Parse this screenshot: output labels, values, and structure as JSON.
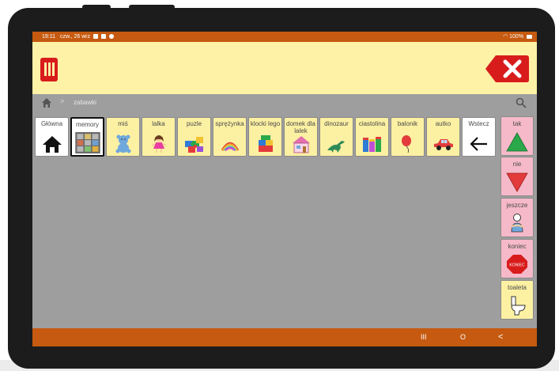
{
  "status_bar": {
    "time": "19:11",
    "date": "czw., 26 wrz",
    "battery": "100%"
  },
  "path": {
    "separator": ">",
    "crumb": "zabawki"
  },
  "tiles": [
    {
      "label": "Główna",
      "icon": "home-icon",
      "style": "white"
    },
    {
      "label": "memory",
      "icon": "memory-game-icon",
      "style": "white",
      "selected": true
    },
    {
      "label": "miś",
      "icon": "teddy-bear-icon",
      "style": "yellow"
    },
    {
      "label": "lalka",
      "icon": "doll-icon",
      "style": "yellow"
    },
    {
      "label": "puzle",
      "icon": "puzzle-icon",
      "style": "yellow"
    },
    {
      "label": "sprężynka",
      "icon": "slinky-icon",
      "style": "yellow"
    },
    {
      "label": "klocki lego",
      "icon": "lego-bricks-icon",
      "style": "yellow"
    },
    {
      "label": "domek dla lalek",
      "icon": "dollhouse-icon",
      "style": "yellow"
    },
    {
      "label": "dinozaur",
      "icon": "dinosaur-icon",
      "style": "yellow"
    },
    {
      "label": "ciastolina",
      "icon": "play-dough-icon",
      "style": "yellow"
    },
    {
      "label": "balonik",
      "icon": "balloon-icon",
      "style": "yellow"
    },
    {
      "label": "autko",
      "icon": "toy-car-icon",
      "style": "yellow"
    },
    {
      "label": "Wstecz",
      "icon": "back-arrow-icon",
      "style": "white"
    }
  ],
  "side_tiles": [
    {
      "label": "tak",
      "icon": "green-triangle-icon",
      "style": "pink"
    },
    {
      "label": "nie",
      "icon": "red-triangle-icon",
      "style": "pink"
    },
    {
      "label": "jeszcze",
      "icon": "more-gesture-icon",
      "style": "pink"
    },
    {
      "label": "koniec",
      "icon": "stop-sign-icon",
      "style": "pink",
      "sign_text": "KONIEC"
    },
    {
      "label": "toaleta",
      "icon": "toilet-icon",
      "style": "yellow"
    }
  ],
  "nav_buttons": {
    "recents": "III",
    "home": "O",
    "back": "<"
  },
  "colors": {
    "toolbar_bg": "#fdf2a6",
    "status_bar_bg": "#c55a10",
    "grid_bg": "#9e9e9e",
    "tile_yellow": "#fcf0a3",
    "tile_pink": "#f5b9c9",
    "close_red": "#d81c1c"
  }
}
